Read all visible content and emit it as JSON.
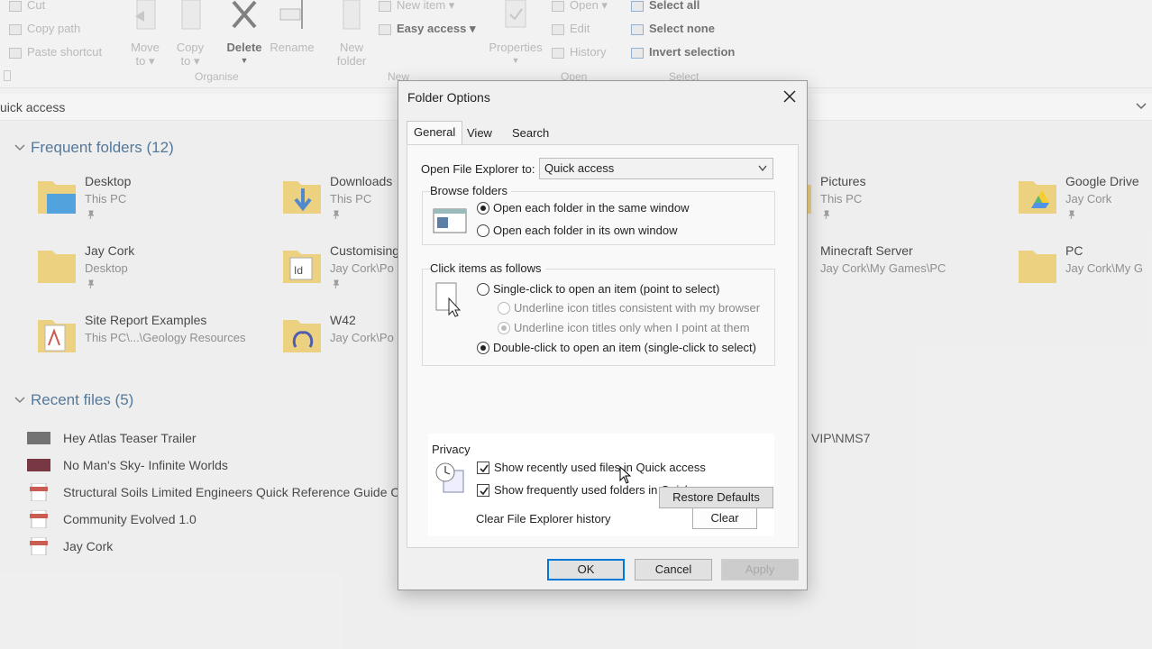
{
  "ribbon": {
    "clipboard": {
      "cut": "Cut",
      "copy_path": "Copy path",
      "paste_shortcut": "Paste shortcut"
    },
    "organise": {
      "move_to_1": "Move",
      "move_to_2": "to",
      "copy_to_1": "Copy",
      "copy_to_2": "to",
      "delete": "Delete",
      "rename": "Rename",
      "label": "Organise"
    },
    "new": {
      "new_folder_1": "New",
      "new_folder_2": "folder",
      "new_item": "New item",
      "easy_access": "Easy access",
      "label": "New"
    },
    "open": {
      "properties": "Properties",
      "open": "Open",
      "edit": "Edit",
      "history": "History",
      "label": "Open"
    },
    "select": {
      "select_all": "Select all",
      "select_none": "Select none",
      "invert_selection": "Invert selection",
      "label": "Select"
    }
  },
  "address": {
    "path": "uick access"
  },
  "content": {
    "frequent_header": "Frequent folders (12)",
    "frequent": [
      {
        "name": "Desktop",
        "sub": "This PC"
      },
      {
        "name": "Downloads",
        "sub": "This PC"
      },
      {
        "name": "Pictures",
        "sub": "This PC"
      },
      {
        "name": "Google Drive",
        "sub": "Jay Cork"
      },
      {
        "name": "Jay Cork",
        "sub": "Desktop"
      },
      {
        "name": "Customising",
        "sub": "Jay Cork\\Po"
      },
      {
        "name": "Minecraft Server",
        "sub": "Jay Cork\\My Games\\PC"
      },
      {
        "name": "PC",
        "sub": "Jay Cork\\My G"
      },
      {
        "name": "Site Report Examples",
        "sub": "This PC\\...\\Geology Resources"
      },
      {
        "name": "W42",
        "sub": "Jay Cork\\Po"
      }
    ],
    "recent_header": "Recent files (5)",
    "recent": [
      "Hey Atlas Teaser Trailer",
      "No Man's Sky- Infinite Worlds",
      "Structural Soils Limited Engineers Quick Reference Guide O",
      "Community Evolved 1.0",
      "Jay Cork"
    ],
    "recent_path_fragment": "VIP\\NMS7"
  },
  "dialog": {
    "title": "Folder Options",
    "tabs": [
      "General",
      "View",
      "Search"
    ],
    "open_explorer_label": "Open File Explorer to:",
    "open_explorer_value": "Quick access",
    "browse": {
      "label": "Browse folders",
      "same_window": "Open each folder in the same window",
      "own_window": "Open each folder in its own window"
    },
    "click": {
      "label": "Click items as follows",
      "single": "Single-click to open an item (point to select)",
      "underline_browser": "Underline icon titles consistent with my browser",
      "underline_point": "Underline icon titles only when I point at them",
      "double": "Double-click to open an item (single-click to select)"
    },
    "privacy": {
      "label": "Privacy",
      "recent_files": "Show recently used files in Quick access",
      "frequent_folders": "Show frequently used folders in Quick access",
      "clear_history": "Clear File Explorer history",
      "clear": "Clear"
    },
    "restore": "Restore Defaults",
    "ok": "OK",
    "cancel": "Cancel",
    "apply": "Apply"
  },
  "colors": {
    "accent": "#0078d7",
    "section_header": "#2e5b86"
  }
}
